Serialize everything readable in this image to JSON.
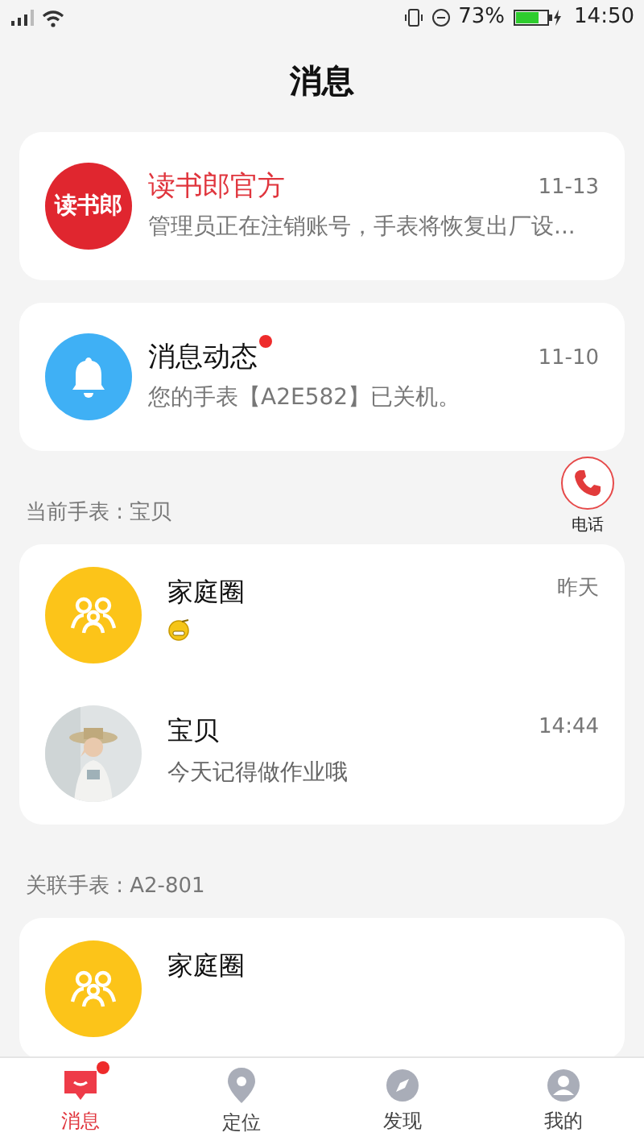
{
  "status_bar": {
    "battery": "73%",
    "time": "14:50"
  },
  "title": "消息",
  "top_cards": [
    {
      "kind": "logo",
      "avatar_text": "读书郎",
      "name": "读书郎官方",
      "official": true,
      "unread": false,
      "time": "11-13",
      "message": "管理员正在注销账号，手表将恢复出厂设..."
    },
    {
      "kind": "bell",
      "name": "消息动态",
      "official": false,
      "unread": true,
      "time": "11-10",
      "message": "您的手表【A2E582】已关机。"
    }
  ],
  "call_button": {
    "label": "电话"
  },
  "sections": [
    {
      "label": "当前手表 : 宝贝",
      "rows": [
        {
          "kind": "family",
          "name": "家庭圈",
          "time": "昨天",
          "sticker": true
        },
        {
          "kind": "picture",
          "name": "宝贝",
          "time": "14:44",
          "sticker": false,
          "message": "今天记得做作业哦"
        }
      ]
    },
    {
      "label": "关联手表 : A2-801",
      "rows": [
        {
          "kind": "family",
          "name": "家庭圈",
          "sticker": false
        }
      ]
    }
  ],
  "tabs": [
    {
      "label": "消息",
      "selected": true,
      "kind": "message",
      "badge": true
    },
    {
      "label": "定位",
      "selected": false,
      "kind": "pin",
      "badge": false
    },
    {
      "label": "发现",
      "selected": false,
      "kind": "compass",
      "badge": false
    },
    {
      "label": "我的",
      "selected": false,
      "kind": "face",
      "badge": false
    }
  ]
}
